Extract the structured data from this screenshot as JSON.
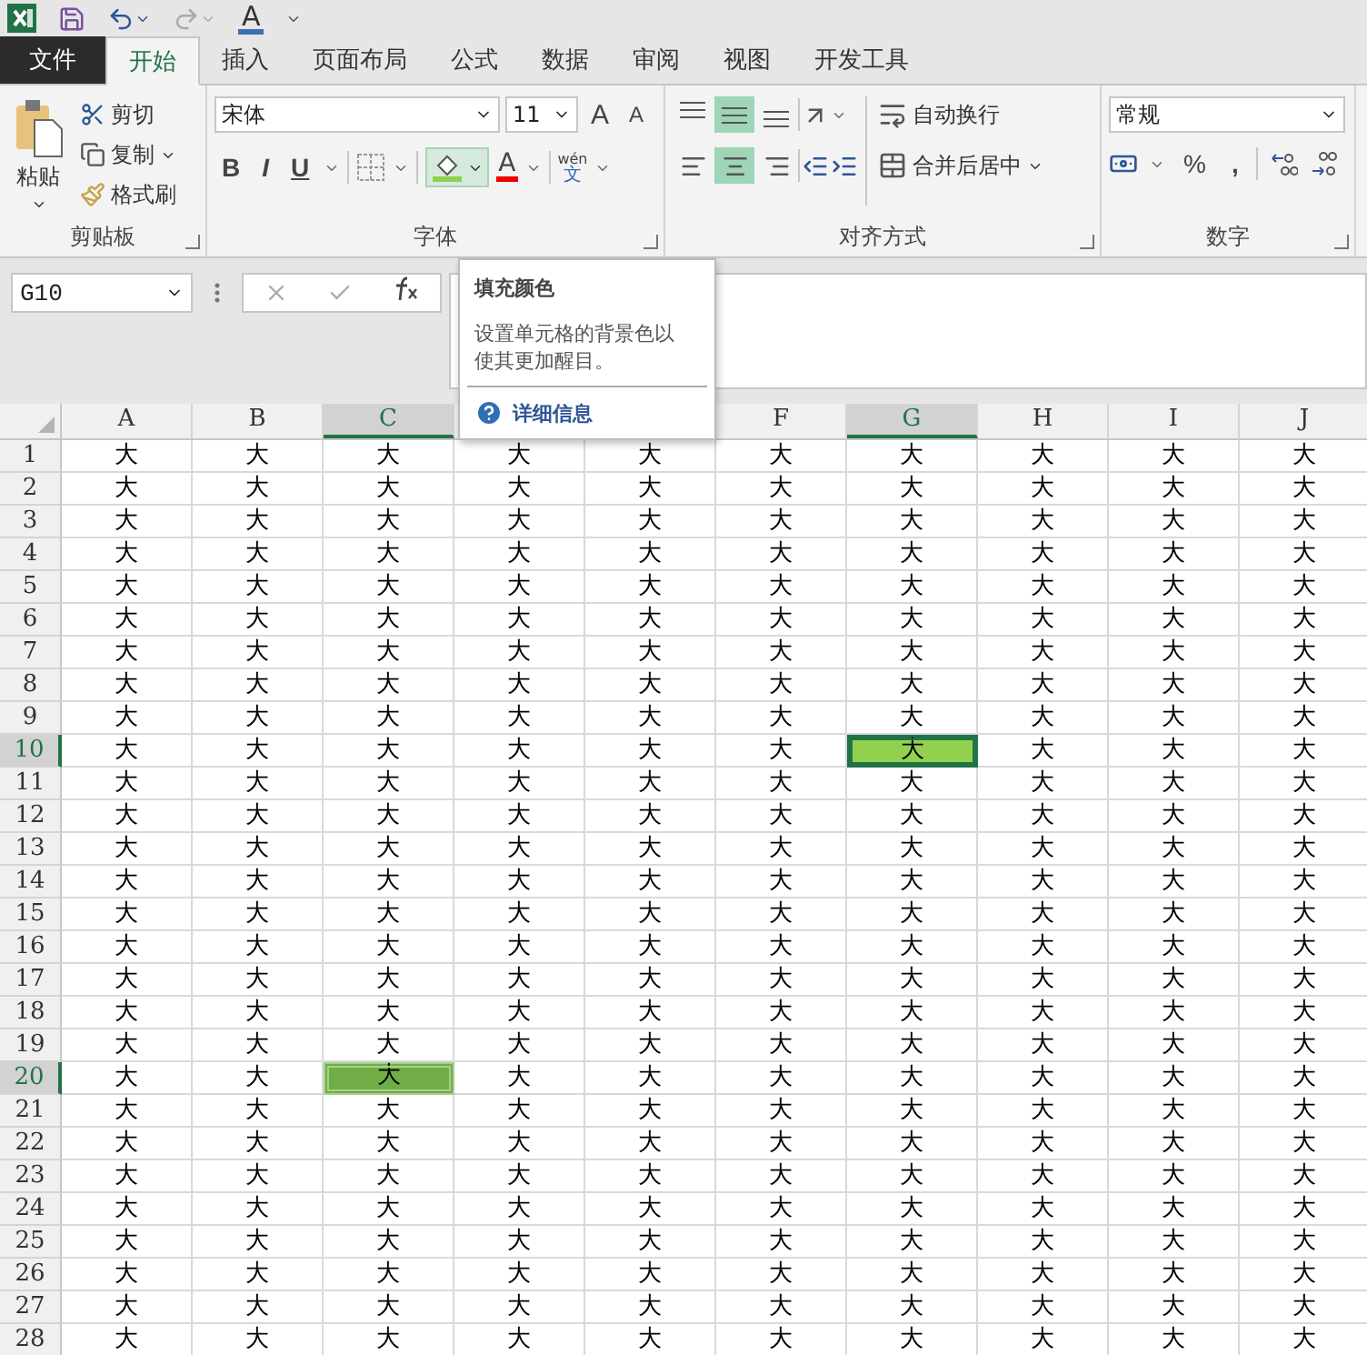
{
  "quick_access": {
    "font_color_label": "A"
  },
  "tabs": [
    {
      "label": "文件",
      "kind": "file",
      "selected": false
    },
    {
      "label": "开始",
      "kind": "tab",
      "selected": true
    },
    {
      "label": "插入",
      "kind": "tab",
      "selected": false
    },
    {
      "label": "页面布局",
      "kind": "tab",
      "selected": false
    },
    {
      "label": "公式",
      "kind": "tab",
      "selected": false
    },
    {
      "label": "数据",
      "kind": "tab",
      "selected": false
    },
    {
      "label": "审阅",
      "kind": "tab",
      "selected": false
    },
    {
      "label": "视图",
      "kind": "tab",
      "selected": false
    },
    {
      "label": "开发工具",
      "kind": "tab",
      "selected": false
    }
  ],
  "ribbon": {
    "clipboard": {
      "title": "剪贴板",
      "paste": "粘贴",
      "cut": "剪切",
      "copy": "复制",
      "format_painter": "格式刷"
    },
    "font": {
      "title": "字体",
      "font_name": "宋体",
      "font_size": "11",
      "grow": "A",
      "shrink": "A",
      "bold": "B",
      "italic": "I",
      "underline": "U",
      "fill_active": true,
      "font_color": "A",
      "phonetic_top": "wén",
      "phonetic_bottom": "文"
    },
    "alignment": {
      "title": "对齐方式",
      "vertical": [
        {
          "selected": false
        },
        {
          "selected": true
        },
        {
          "selected": false
        }
      ],
      "horizontal": [
        {
          "selected": false
        },
        {
          "selected": true
        },
        {
          "selected": false
        }
      ],
      "wrap_text": "自动换行",
      "merge_center": "合并后居中"
    },
    "number": {
      "title": "数字",
      "format": "常规",
      "percent": "%",
      "comma": ","
    }
  },
  "name_box": "G10",
  "tooltip": {
    "title": "填充颜色",
    "description": "设置单元格的背景色以使其更加醒目。",
    "link": "详细信息"
  },
  "columns_left": [
    {
      "label": "A",
      "selected": false
    },
    {
      "label": "B",
      "selected": false
    },
    {
      "label": "C",
      "selected": true
    }
  ],
  "columns_right": [
    {
      "label": "F",
      "selected": false
    },
    {
      "label": "G",
      "selected": true
    },
    {
      "label": "H",
      "selected": false
    },
    {
      "label": "I",
      "selected": false
    },
    {
      "label": "J",
      "selected": false
    }
  ],
  "rows": [
    {
      "header": "1",
      "selected": false,
      "cells": [
        "大",
        "大",
        "大",
        "大",
        "大",
        "大",
        "大",
        "大",
        "大",
        "大"
      ]
    },
    {
      "header": "2",
      "selected": false,
      "cells": [
        "大",
        "大",
        "大",
        "大",
        "大",
        "大",
        "大",
        "大",
        "大",
        "大"
      ]
    },
    {
      "header": "3",
      "selected": false,
      "cells": [
        "大",
        "大",
        "大",
        "大",
        "大",
        "大",
        "大",
        "大",
        "大",
        "大"
      ]
    },
    {
      "header": "4",
      "selected": false,
      "cells": [
        "大",
        "大",
        "大",
        "大",
        "大",
        "大",
        "大",
        "大",
        "大",
        "大"
      ]
    },
    {
      "header": "5",
      "selected": false,
      "cells": [
        "大",
        "大",
        "大",
        "大",
        "大",
        "大",
        "大",
        "大",
        "大",
        "大"
      ]
    },
    {
      "header": "6",
      "selected": false,
      "cells": [
        "大",
        "大",
        "大",
        "大",
        "大",
        "大",
        "大",
        "大",
        "大",
        "大"
      ]
    },
    {
      "header": "7",
      "selected": false,
      "cells": [
        "大",
        "大",
        "大",
        "大",
        "大",
        "大",
        "大",
        "大",
        "大",
        "大"
      ]
    },
    {
      "header": "8",
      "selected": false,
      "cells": [
        "大",
        "大",
        "大",
        "大",
        "大",
        "大",
        "大",
        "大",
        "大",
        "大"
      ]
    },
    {
      "header": "9",
      "selected": false,
      "cells": [
        "大",
        "大",
        "大",
        "大",
        "大",
        "大",
        "大",
        "大",
        "大",
        "大"
      ]
    },
    {
      "header": "10",
      "selected": true,
      "cells": [
        "大",
        "大",
        "大",
        "大",
        "大",
        "大",
        {
          "text": "大",
          "color": "#92d050",
          "active": true
        },
        "大",
        "大",
        "大"
      ]
    },
    {
      "header": "11",
      "selected": false,
      "cells": [
        "大",
        "大",
        "大",
        "大",
        "大",
        "大",
        "大",
        "大",
        "大",
        "大"
      ]
    },
    {
      "header": "12",
      "selected": false,
      "cells": [
        "大",
        "大",
        "大",
        "大",
        "大",
        "大",
        "大",
        "大",
        "大",
        "大"
      ]
    },
    {
      "header": "13",
      "selected": false,
      "cells": [
        "大",
        "大",
        "大",
        "大",
        "大",
        "大",
        "大",
        "大",
        "大",
        "大"
      ]
    },
    {
      "header": "14",
      "selected": false,
      "cells": [
        "大",
        "大",
        "大",
        "大",
        "大",
        "大",
        "大",
        "大",
        "大",
        "大"
      ]
    },
    {
      "header": "15",
      "selected": false,
      "cells": [
        "大",
        "大",
        "大",
        "大",
        "大",
        "大",
        "大",
        "大",
        "大",
        "大"
      ]
    },
    {
      "header": "16",
      "selected": false,
      "cells": [
        "大",
        "大",
        "大",
        "大",
        "大",
        "大",
        "大",
        "大",
        "大",
        "大"
      ]
    },
    {
      "header": "17",
      "selected": false,
      "cells": [
        "大",
        "大",
        "大",
        "大",
        "大",
        "大",
        "大",
        "大",
        "大",
        "大"
      ]
    },
    {
      "header": "18",
      "selected": false,
      "cells": [
        "大",
        "大",
        "大",
        "大",
        "大",
        "大",
        "大",
        "大",
        "大",
        "大"
      ]
    },
    {
      "header": "19",
      "selected": false,
      "cells": [
        "大",
        "大",
        "大",
        "大",
        "大",
        "大",
        "大",
        "大",
        "大",
        "大"
      ]
    },
    {
      "header": "20",
      "selected": true,
      "cells": [
        "大",
        "大",
        {
          "text": "大",
          "color": "#70ad47",
          "active": false
        },
        "大",
        "大",
        "大",
        "大",
        "大",
        "大",
        "大"
      ]
    },
    {
      "header": "21",
      "selected": false,
      "cells": [
        "大",
        "大",
        "大",
        "大",
        "大",
        "大",
        "大",
        "大",
        "大",
        "大"
      ]
    },
    {
      "header": "22",
      "selected": false,
      "cells": [
        "大",
        "大",
        "大",
        "大",
        "大",
        "大",
        "大",
        "大",
        "大",
        "大"
      ]
    },
    {
      "header": "23",
      "selected": false,
      "cells": [
        "大",
        "大",
        "大",
        "大",
        "大",
        "大",
        "大",
        "大",
        "大",
        "大"
      ]
    },
    {
      "header": "24",
      "selected": false,
      "cells": [
        "大",
        "大",
        "大",
        "大",
        "大",
        "大",
        "大",
        "大",
        "大",
        "大"
      ]
    },
    {
      "header": "25",
      "selected": false,
      "cells": [
        "大",
        "大",
        "大",
        "大",
        "大",
        "大",
        "大",
        "大",
        "大",
        "大"
      ]
    },
    {
      "header": "26",
      "selected": false,
      "cells": [
        "大",
        "大",
        "大",
        "大",
        "大",
        "大",
        "大",
        "大",
        "大",
        "大"
      ]
    },
    {
      "header": "27",
      "selected": false,
      "cells": [
        "大",
        "大",
        "大",
        "大",
        "大",
        "大",
        "大",
        "大",
        "大",
        "大"
      ]
    },
    {
      "header": "28",
      "selected": false,
      "cells": [
        "大",
        "大",
        "大",
        "大",
        "大",
        "大",
        "大",
        "大",
        "大",
        "大"
      ]
    }
  ]
}
